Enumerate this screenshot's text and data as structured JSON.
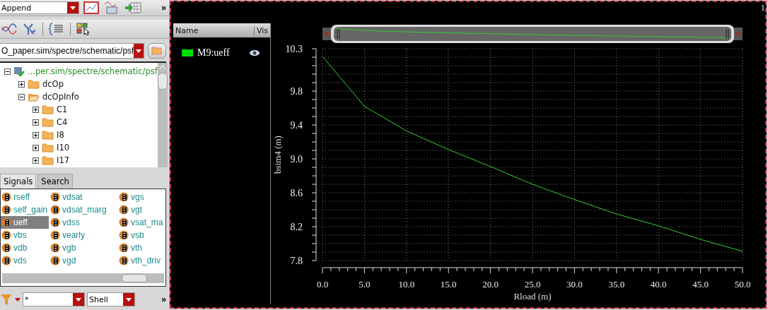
{
  "toolbar": {
    "mode_dropdown": "Append",
    "overflow": "»"
  },
  "path_field": {
    "value": "O_paper.sim/spectre/schematic/psf"
  },
  "tree": [
    {
      "label": "...per.sim/spectre/schematic/psf",
      "kind": "dataset",
      "expanded": true,
      "children": [
        {
          "label": "dcOp",
          "kind": "folder",
          "expanded": false
        },
        {
          "label": "dcOpInfo",
          "kind": "folder",
          "expanded": true,
          "children": [
            {
              "label": "C1",
              "kind": "folder",
              "expanded": false
            },
            {
              "label": "C4",
              "kind": "folder",
              "expanded": false
            },
            {
              "label": "I8",
              "kind": "folder",
              "expanded": false
            },
            {
              "label": "I10",
              "kind": "folder",
              "expanded": false
            },
            {
              "label": "I17",
              "kind": "folder",
              "expanded": false
            }
          ]
        }
      ]
    }
  ],
  "tabs": [
    {
      "label": "Signals",
      "selected": true
    },
    {
      "label": "Search",
      "selected": false
    }
  ],
  "signals": [
    {
      "name": "rseff",
      "selected": false
    },
    {
      "name": "self_gain",
      "selected": false
    },
    {
      "name": "ueff",
      "selected": true
    },
    {
      "name": "vbs",
      "selected": false
    },
    {
      "name": "vdb",
      "selected": false
    },
    {
      "name": "vds",
      "selected": false
    },
    {
      "name": "vdsat",
      "selected": false
    },
    {
      "name": "vdsat_marg",
      "selected": false
    },
    {
      "name": "vdss",
      "selected": false
    },
    {
      "name": "vearly",
      "selected": false
    },
    {
      "name": "vgb",
      "selected": false
    },
    {
      "name": "vgd",
      "selected": false
    },
    {
      "name": "vgs",
      "selected": false
    },
    {
      "name": "vgt",
      "selected": false
    },
    {
      "name": "vsat_ma",
      "selected": false
    },
    {
      "name": "vsb",
      "selected": false
    },
    {
      "name": "vth",
      "selected": false
    },
    {
      "name": "vth_driv",
      "selected": false
    }
  ],
  "filter_bar": {
    "filter_value": "*",
    "shell_dropdown": "Shell",
    "overflow": "»"
  },
  "legend": {
    "columns": [
      "Name",
      "Vis"
    ],
    "items": [
      {
        "color": "#00dd00",
        "visible": true
      }
    ]
  },
  "corner_label": "1",
  "chart": {
    "chart_data": {
      "type": "line",
      "grid": true,
      "xlabel": "Rload (m)",
      "ylabel": "bsim4 (m)",
      "x": [
        0,
        5,
        10,
        15,
        20,
        25,
        30,
        35,
        40,
        45,
        50
      ],
      "series": [
        {
          "name": "M9:ueff",
          "color": "#33cc33",
          "values": [
            10.21,
            9.62,
            9.33,
            9.11,
            8.91,
            8.7,
            8.52,
            8.35,
            8.21,
            8.05,
            7.91
          ]
        }
      ],
      "xlim": [
        0,
        50
      ],
      "ylim": [
        7.8,
        10.3
      ],
      "xticks": [
        {
          "value": 0,
          "label": "0.0"
        },
        {
          "value": 5,
          "label": "5.0"
        },
        {
          "value": 10,
          "label": "10.0"
        },
        {
          "value": 15,
          "label": "15.0"
        },
        {
          "value": 20,
          "label": "20.0"
        },
        {
          "value": 25,
          "label": "25.0"
        },
        {
          "value": 30,
          "label": "30.0"
        },
        {
          "value": 35,
          "label": "35.0"
        },
        {
          "value": 40,
          "label": "40.0"
        },
        {
          "value": 45,
          "label": "45.0"
        },
        {
          "value": 50,
          "label": "50.0"
        }
      ],
      "yticks": [
        {
          "value": 7.8,
          "label": "7.8"
        },
        {
          "value": 8.2,
          "label": "8.2"
        },
        {
          "value": 8.6,
          "label": "8.6"
        },
        {
          "value": 9.0,
          "label": "9.0"
        },
        {
          "value": 9.4,
          "label": "9.4"
        },
        {
          "value": 9.8,
          "label": "9.8"
        },
        {
          "value": 10.3,
          "label": "10.3"
        }
      ]
    }
  }
}
